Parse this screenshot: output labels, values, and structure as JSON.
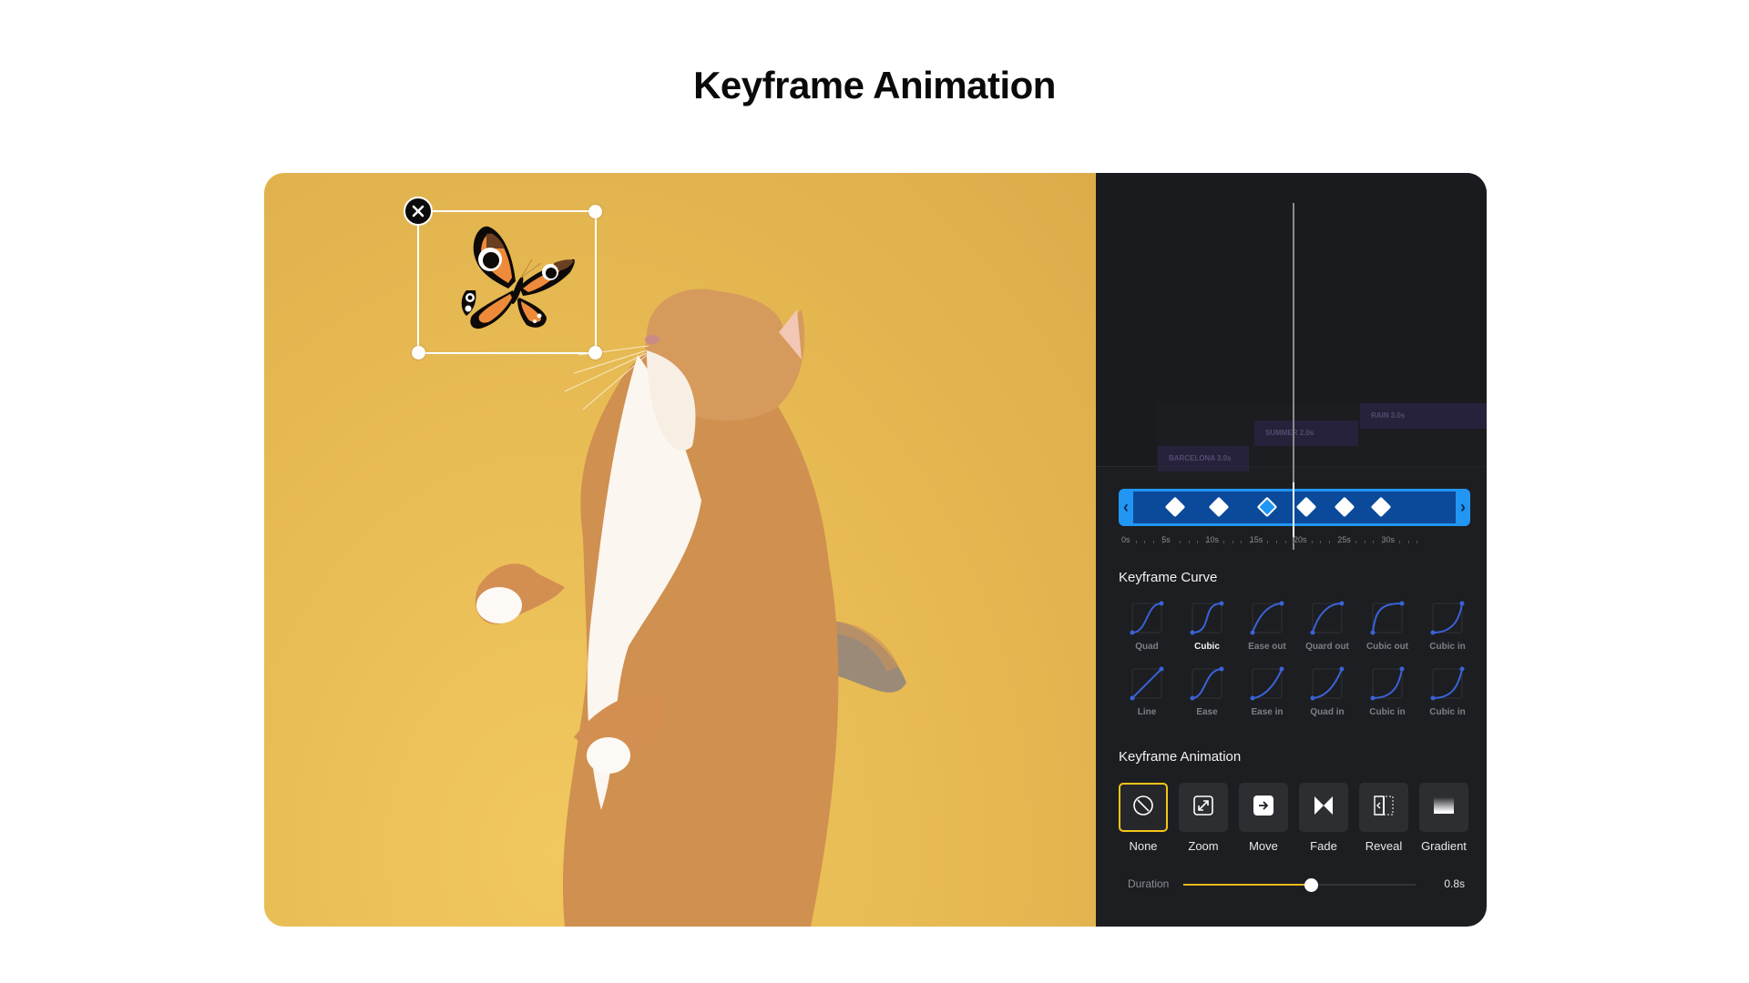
{
  "page": {
    "title": "Keyframe Animation"
  },
  "canvas": {
    "background_color": "#e6b955",
    "image_subject": "orange tabby cat standing on hind legs looking up",
    "sticker": {
      "name": "butterfly",
      "selected": true,
      "delete_icon": "close-icon"
    }
  },
  "preview": {
    "ghost_tracks": [
      {
        "label": "BARCELONA 3.0s"
      },
      {
        "label": "SUMMER 2.0s"
      },
      {
        "label": "RAIN 3.0s"
      }
    ]
  },
  "timeline": {
    "accent_color": "#2196f3",
    "prev_icon": "chevron-left-icon",
    "next_icon": "chevron-right-icon",
    "keyframes_s": [
      4.5,
      9.5,
      15,
      19.5,
      23.8,
      28
    ],
    "active_keyframe_index": 2,
    "playhead_s": 15,
    "ruler": {
      "labels": [
        "0s",
        "5s",
        "10s",
        "15s",
        "20s",
        "25s",
        "30s"
      ],
      "max_s": 33
    }
  },
  "curves": {
    "title": "Keyframe Curve",
    "selected": "Cubic",
    "items": [
      {
        "label": "Quad",
        "type": "ease-in-out-quad"
      },
      {
        "label": "Cubic",
        "type": "ease-in-out-cubic"
      },
      {
        "label": "Ease out",
        "type": "ease-out"
      },
      {
        "label": "Quard out",
        "type": "ease-out-quad"
      },
      {
        "label": "Cubic out",
        "type": "ease-out-cubic"
      },
      {
        "label": "Cubic in",
        "type": "ease-in-cubic"
      },
      {
        "label": "Line",
        "type": "linear"
      },
      {
        "label": "Ease",
        "type": "ease"
      },
      {
        "label": "Ease in",
        "type": "ease-in"
      },
      {
        "label": "Quad in",
        "type": "ease-in-quad"
      },
      {
        "label": "Cubic in",
        "type": "ease-in-cubic-2"
      },
      {
        "label": "Cubic in",
        "type": "ease-in-cubic-3"
      }
    ],
    "curve_color": "#3a63d8"
  },
  "animation": {
    "title": "Keyframe Animation",
    "selected": "None",
    "selected_border_color": "#f5c518",
    "items": [
      {
        "label": "None",
        "icon": "none-icon"
      },
      {
        "label": "Zoom",
        "icon": "zoom-icon"
      },
      {
        "label": "Move",
        "icon": "move-icon"
      },
      {
        "label": "Fade",
        "icon": "fade-icon"
      },
      {
        "label": "Reveal",
        "icon": "reveal-icon"
      },
      {
        "label": "Gradient",
        "icon": "gradient-icon"
      }
    ]
  },
  "duration": {
    "label": "Duration",
    "value_text": "0.8s",
    "fraction": 0.55,
    "accent_color": "#f0b81c"
  }
}
